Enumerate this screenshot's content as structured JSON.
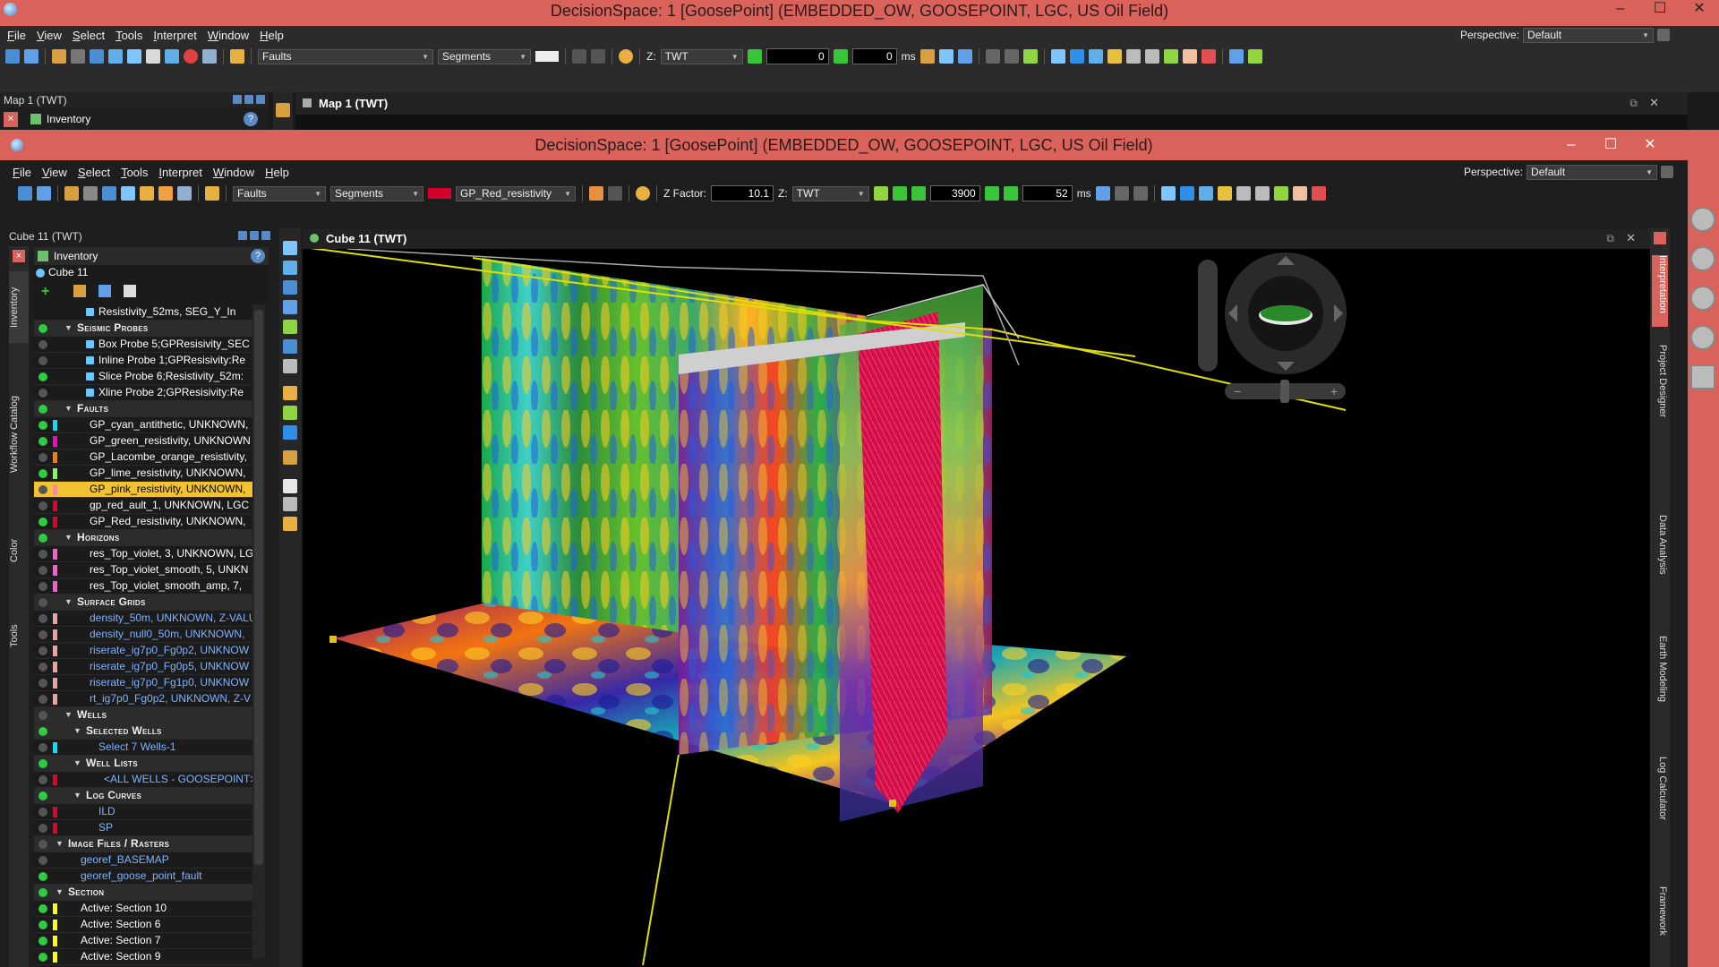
{
  "back_window": {
    "title": "DecisionSpace: 1 [GoosePoint] (EMBEDDED_OW, GOOSEPOINT, LGC, US Oil Field)",
    "menu": [
      "File",
      "View",
      "Select",
      "Tools",
      "Interpret",
      "Window",
      "Help"
    ],
    "perspective_label": "Perspective:",
    "perspective_value": "Default",
    "toolbar": {
      "faults_combo": "Faults",
      "segments_combo": "Segments",
      "z_label": "Z:",
      "z_value": "TWT",
      "time_value": "0",
      "step_value": "0",
      "unit": "ms"
    },
    "left_panel_title": "Map 1 (TWT)",
    "inventory_title": "Inventory",
    "view_title": "Map 1 (TWT)"
  },
  "front_window": {
    "title": "DecisionSpace: 1 [GoosePoint] (EMBEDDED_OW, GOOSEPOINT, LGC, US Oil Field)",
    "menu": [
      "File",
      "View",
      "Select",
      "Tools",
      "Interpret",
      "Window",
      "Help"
    ],
    "perspective_label": "Perspective:",
    "perspective_value": "Default",
    "toolbar": {
      "faults_combo": "Faults",
      "segments_combo": "Segments",
      "active_fault": "GP_Red_resistivity",
      "active_fault_color": "#d4002a",
      "zfactor_label": "Z Factor:",
      "zfactor_value": "10.1",
      "z_label": "Z:",
      "z_value": "TWT",
      "time_value": "3900",
      "step_value": "52",
      "unit": "ms"
    },
    "left_panel_title": "Cube 11 (TWT)",
    "inventory_title": "Inventory",
    "inventory_subtitle": "Cube 11",
    "view_title": "Cube 11 (TWT)",
    "left_tabs": [
      "Inventory",
      "Workflow Catalog",
      "Color",
      "Tools"
    ],
    "right_tabs": [
      "Interpretation",
      "Project Designer",
      "Data Analysis",
      "Earth Modeling",
      "Log Calculator",
      "Framework"
    ]
  },
  "tree": [
    {
      "text": "Resistivity_52ms, SEG_Y_In",
      "indent": 72,
      "type": "item",
      "dot": "",
      "bar": "",
      "icon": true
    },
    {
      "text": "Seismic Probes",
      "indent": 48,
      "type": "cat",
      "dot": "#2ecc40"
    },
    {
      "text": "Box Probe 5;GPResisivity_SEC",
      "indent": 72,
      "type": "item",
      "dot": "#555",
      "icon": true
    },
    {
      "text": "Inline Probe 1;GPResisivity:Re",
      "indent": 72,
      "type": "item",
      "dot": "#555",
      "icon": true
    },
    {
      "text": "Slice Probe 6;Resistivity_52m:",
      "indent": 72,
      "type": "item",
      "dot": "#2ecc40",
      "icon": true
    },
    {
      "text": "Xline Probe 2;GPResisivity:Re",
      "indent": 72,
      "type": "item",
      "dot": "#555",
      "icon": true
    },
    {
      "text": "Faults",
      "indent": 48,
      "type": "cat",
      "dot": "#2ecc40"
    },
    {
      "text": "GP_cyan_antithetic, UNKNOWN,",
      "indent": 62,
      "type": "item",
      "dot": "#2ecc40",
      "bar": "#00e5ff"
    },
    {
      "text": "GP_green_resistivity, UNKNOWN",
      "indent": 62,
      "type": "item",
      "dot": "#2ecc40",
      "bar": "#ff00c8"
    },
    {
      "text": "GP_Lacombe_orange_resistivity,",
      "indent": 62,
      "type": "item",
      "dot": "#555",
      "bar": "#ff7a00"
    },
    {
      "text": "GP_lime_resistivity, UNKNOWN,",
      "indent": 62,
      "type": "item",
      "dot": "#2ecc40",
      "bar": "#7cff5a"
    },
    {
      "text": "GP_pink_resistivity, UNKNOWN,",
      "indent": 62,
      "type": "item",
      "dot": "#555",
      "bar": "#ff7fbf",
      "selected": true
    },
    {
      "text": "gp_red_ault_1, UNKNOWN, LGC",
      "indent": 62,
      "type": "item",
      "dot": "#555",
      "bar": "#e0002a"
    },
    {
      "text": "GP_Red_resistivity, UNKNOWN,",
      "indent": 62,
      "type": "item",
      "dot": "#2ecc40",
      "bar": "#e0002a"
    },
    {
      "text": "Horizons",
      "indent": 48,
      "type": "cat",
      "dot": "#2ecc40"
    },
    {
      "text": "res_Top_violet, 3, UNKNOWN, LG",
      "indent": 62,
      "type": "item",
      "dot": "#555",
      "bar": "#ff5ad2"
    },
    {
      "text": "res_Top_violet_smooth, 5, UNKN",
      "indent": 62,
      "type": "item",
      "dot": "#555",
      "bar": "#ff5ad2"
    },
    {
      "text": "res_Top_violet_smooth_amp, 7,",
      "indent": 62,
      "type": "item",
      "dot": "#555",
      "bar": "#ff5ad2"
    },
    {
      "text": "Surface Grids",
      "indent": 48,
      "type": "cat",
      "dot": "#555"
    },
    {
      "text": "density_50m, UNKNOWN, Z-VALU",
      "indent": 62,
      "type": "item",
      "dot": "#555",
      "bar": "#f0a0a0",
      "link": true
    },
    {
      "text": "density_null0_50m, UNKNOWN,",
      "indent": 62,
      "type": "item",
      "dot": "#555",
      "bar": "#f0a0a0",
      "link": true
    },
    {
      "text": "riserate_ig7p0_Fg0p2, UNKNOW",
      "indent": 62,
      "type": "item",
      "dot": "#555",
      "bar": "#f0a0a0",
      "link": true
    },
    {
      "text": "riserate_ig7p0_Fg0p5, UNKNOW",
      "indent": 62,
      "type": "item",
      "dot": "#555",
      "bar": "#f0a0a0",
      "link": true
    },
    {
      "text": "riserate_ig7p0_Fg1p0, UNKNOW",
      "indent": 62,
      "type": "item",
      "dot": "#555",
      "bar": "#f0a0a0",
      "link": true
    },
    {
      "text": "rt_ig7p0_Fg0p2, UNKNOWN, Z-V",
      "indent": 62,
      "type": "item",
      "dot": "#555",
      "bar": "#f0a0a0",
      "link": true
    },
    {
      "text": "Wells",
      "indent": 48,
      "type": "cat",
      "dot": "#555"
    },
    {
      "text": "Selected Wells",
      "indent": 58,
      "type": "cat",
      "dot": "#2ecc40"
    },
    {
      "text": "Select 7 Wells-1",
      "indent": 72,
      "type": "item",
      "dot": "#555",
      "bar": "#00e5ff",
      "link": true
    },
    {
      "text": "Well Lists",
      "indent": 58,
      "type": "cat",
      "dot": "#2ecc40"
    },
    {
      "text": "<ALL WELLS - GOOSEPOINT>",
      "indent": 78,
      "type": "item",
      "dot": "#555",
      "bar": "#e0002a",
      "link": true
    },
    {
      "text": "Log Curves",
      "indent": 58,
      "type": "cat",
      "dot": "#2ecc40"
    },
    {
      "text": "ILD",
      "indent": 72,
      "type": "item",
      "dot": "#555",
      "bar": "#e0002a",
      "link": true
    },
    {
      "text": "SP",
      "indent": 72,
      "type": "item",
      "dot": "#555",
      "bar": "#e0002a",
      "link": true
    },
    {
      "text": "Image Files / Rasters",
      "indent": 38,
      "type": "cat",
      "dot": "#555"
    },
    {
      "text": "georef_BASEMAP",
      "indent": 52,
      "type": "item",
      "dot": "#555",
      "link": true
    },
    {
      "text": "georef_goose_point_fault",
      "indent": 52,
      "type": "item",
      "dot": "#2ecc40",
      "link": true
    },
    {
      "text": "Section",
      "indent": 38,
      "type": "cat",
      "dot": "#2ecc40"
    },
    {
      "text": "Active: Section 10",
      "indent": 52,
      "type": "item",
      "dot": "#2ecc40",
      "bar": "#ffff00"
    },
    {
      "text": "Active: Section 6",
      "indent": 52,
      "type": "item",
      "dot": "#2ecc40",
      "bar": "#ffff00"
    },
    {
      "text": "Active: Section 7",
      "indent": 52,
      "type": "item",
      "dot": "#2ecc40",
      "bar": "#ffff00"
    },
    {
      "text": "Active: Section 9",
      "indent": 52,
      "type": "item",
      "dot": "#2ecc40",
      "bar": "#ffff00"
    }
  ]
}
